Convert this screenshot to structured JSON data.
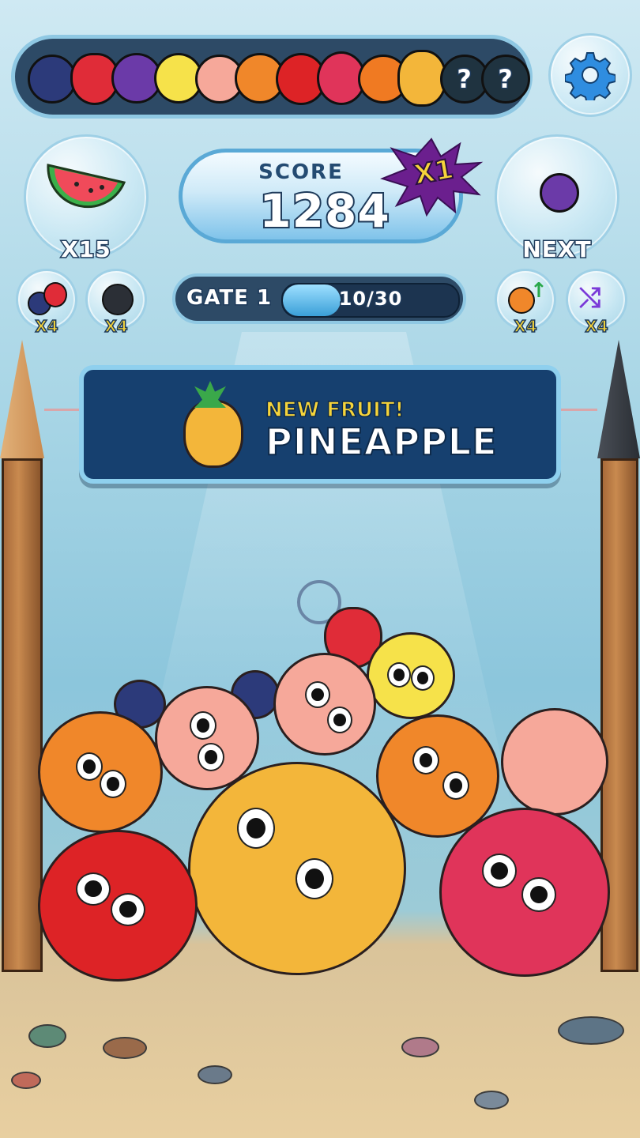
{
  "evolution_bar": {
    "fruits": [
      "blueberry",
      "strawberry",
      "plum",
      "lemon",
      "peach",
      "orange",
      "apple",
      "dragonfruit",
      "persimmon",
      "pineapple"
    ],
    "locked": [
      "?",
      "?"
    ]
  },
  "settings": {
    "icon": "gear-icon"
  },
  "powerup_watermelon": {
    "count": "X15"
  },
  "score": {
    "label": "SCORE",
    "value": "1284",
    "multiplier": "X1"
  },
  "next": {
    "label": "NEXT",
    "fruit": "plum"
  },
  "tools": [
    {
      "name": "fruit-swap",
      "count": "X4"
    },
    {
      "name": "bomb",
      "count": "X4"
    },
    {
      "name": "upgrade",
      "count": "X4"
    },
    {
      "name": "shuffle",
      "count": "X4"
    }
  ],
  "gate": {
    "label": "GATE 1",
    "progress_text": "10/30",
    "progress_fraction": 0.33
  },
  "banner": {
    "kicker": "NEW FRUIT!",
    "title": "PINEAPPLE"
  },
  "colors": {
    "panel_dark": "#16406f",
    "accent_yellow": "#f6d43a",
    "bar_fill": "#4fb3e3"
  }
}
